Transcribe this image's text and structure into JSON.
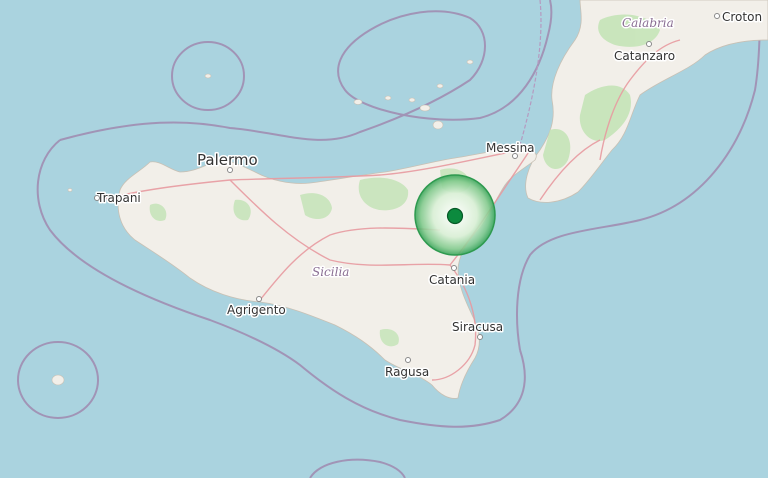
{
  "map": {
    "water_color": "#aad3df",
    "land_color": "#f2efe9",
    "forest_color": "#c5e4b8",
    "border_color": "#9e7fa8",
    "road_color": "#e89aa0",
    "marker_color": "#0c8a3e"
  },
  "labels": {
    "palermo": "Palermo",
    "trapani": "Trapani",
    "messina": "Messina",
    "catania": "Catania",
    "siracusa": "Siracusa",
    "ragusa": "Ragusa",
    "agrigento": "Agrigento",
    "sicilia": "Sicilia",
    "calabria": "Calabria",
    "catanzaro": "Catanzaro",
    "crotone": "Croton"
  },
  "marker": {
    "name": "epicenter-marker",
    "icon": "epicenter-circle"
  }
}
